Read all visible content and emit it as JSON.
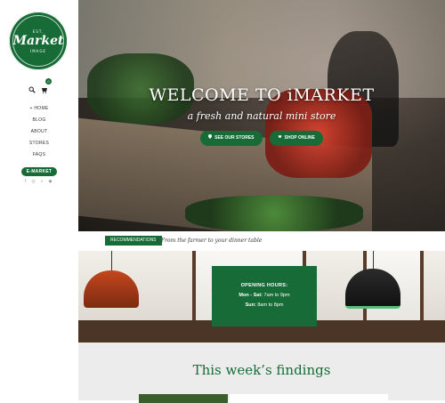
{
  "sidebar": {
    "logo": {
      "est": "EST.",
      "brand": "Market",
      "sub": "IMAGE"
    },
    "cart_count": "0",
    "nav": [
      {
        "label": "HOME",
        "prefix": "+ "
      },
      {
        "label": "BLOG"
      },
      {
        "label": "ABOUT"
      },
      {
        "label": "STORES"
      },
      {
        "label": "FAQS"
      },
      {
        "label": "E-MARKET",
        "active": true
      }
    ],
    "social": [
      "f",
      "◎",
      "⌕",
      "◆"
    ]
  },
  "hero": {
    "title": "WELCOME TO iMARKET",
    "tagline": "a fresh and natural mini store",
    "buttons": [
      {
        "label": "SEE OUR STORES",
        "icon": "map-pin-icon"
      },
      {
        "label": "SHOP ONLINE",
        "icon": "cart-icon"
      }
    ]
  },
  "breadcrumb": {
    "tag": "RECOMMENDATIONS",
    "text": "From the farmer to your dinner table",
    "separator": ">"
  },
  "hours": {
    "title": "OPENING HOURS:",
    "lines": [
      {
        "days": "Mon - Sat:",
        "time": "7am to 9pm"
      },
      {
        "days": "Sun:",
        "time": "8am to 8pm"
      }
    ]
  },
  "findings": {
    "title": "This week’s findings"
  },
  "colors": {
    "brand": "#176b36"
  }
}
